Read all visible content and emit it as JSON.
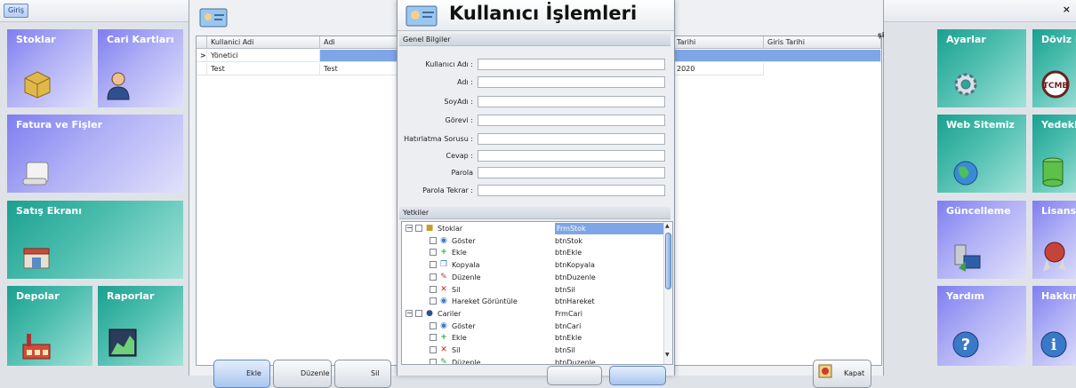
{
  "topbar": {
    "tab_label": "Giriş",
    "close_label": "×"
  },
  "tiles": {
    "stoklar": "Stoklar",
    "cari": "Cari Kartları",
    "fatura": "Fatura ve Fişler",
    "satis": "Satış Ekranı",
    "depolar": "Depolar",
    "raporlar": "Raporlar",
    "ayarlar": "Ayarlar",
    "doviz": "Döviz Kurl",
    "web": "Web Sitemiz",
    "yedek": "Yedeklem",
    "guncelleme": "Güncelleme",
    "lisans": "Lisans Bilg",
    "yardim": "Yardım",
    "hakkimizda": "Hakkımızd"
  },
  "user_grid": {
    "headers": [
      "Kullanici Adi",
      "Adi",
      "Tarihi",
      "Giris Tarihi"
    ],
    "hidden_header_fragment": "şi",
    "row_marker": ">",
    "rows": [
      {
        "username": "Yönetici",
        "name": "",
        "date": ""
      },
      {
        "username": "Test",
        "name": "Test",
        "date": "2020"
      }
    ],
    "buttons": {
      "ekle": "Ekle",
      "duzenle": "Düzenle",
      "sil": "Sil",
      "kapat": "Kapat"
    }
  },
  "dialog": {
    "title": "Kullanıcı İşlemleri",
    "general_section": "Genel Bilgiler",
    "fields": [
      {
        "label": "Kullanıcı Adı :",
        "value": ""
      },
      {
        "label": "Adı :",
        "value": ""
      },
      {
        "label": "SoyAdı :",
        "value": ""
      },
      {
        "label": "Görevi :",
        "value": ""
      },
      {
        "label": "Hatırlatma Sorusu :",
        "value": ""
      },
      {
        "label": "Cevap :",
        "value": ""
      },
      {
        "label": "Parola",
        "value": ""
      },
      {
        "label": "Parola Tekrar :",
        "value": ""
      }
    ],
    "permissions_section": "Yetkiler",
    "tree": [
      {
        "name": "Stoklar",
        "code": "FrmStok",
        "level": 0,
        "icon": "box-icon",
        "selected": true
      },
      {
        "name": "Göster",
        "code": "btnStok",
        "level": 1,
        "icon": "view-icon"
      },
      {
        "name": "Ekle",
        "code": "btnEkle",
        "level": 1,
        "icon": "plus-icon"
      },
      {
        "name": "Kopyala",
        "code": "btnKopyala",
        "level": 1,
        "icon": "copy-icon"
      },
      {
        "name": "Düzenle",
        "code": "btnDuzenle",
        "level": 1,
        "icon": "edit-icon"
      },
      {
        "name": "Sil",
        "code": "btnSil",
        "level": 1,
        "icon": "delete-icon"
      },
      {
        "name": "Hareket Görüntüle",
        "code": "btnHareket",
        "level": 1,
        "icon": "view-icon"
      },
      {
        "name": "Cariler",
        "code": "FrmCari",
        "level": 0,
        "icon": "person-icon"
      },
      {
        "name": "Göster",
        "code": "btnCari",
        "level": 1,
        "icon": "view-icon"
      },
      {
        "name": "Ekle",
        "code": "btnEkle",
        "level": 1,
        "icon": "plus-icon"
      },
      {
        "name": "Sil",
        "code": "btnSil",
        "level": 1,
        "icon": "delete-icon"
      },
      {
        "name": "Düzenle",
        "code": "btnDuzenle",
        "level": 1,
        "icon": "edit-icon"
      }
    ]
  },
  "colors": {
    "tile_blue": "#8a8af2",
    "tile_teal": "#2aa898",
    "selection": "#7ea6e6"
  }
}
